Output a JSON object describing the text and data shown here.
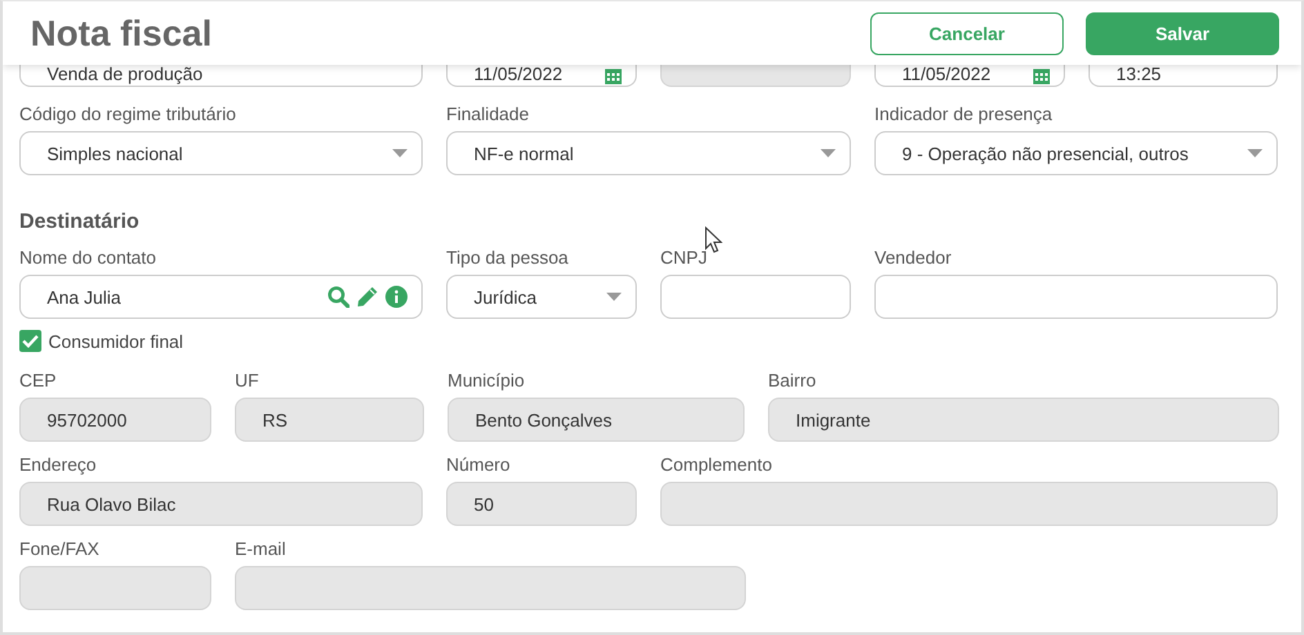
{
  "header": {
    "title": "Nota fiscal",
    "buttons": [
      {
        "label": "Cancelar",
        "kind": "secondary"
      },
      {
        "label": "Salvar",
        "kind": "primary"
      }
    ]
  },
  "top_fields": [
    {
      "kind": "text",
      "value": "Venda de produção",
      "disabled": false
    },
    {
      "kind": "date",
      "value": "11/05/2022",
      "disabled": false
    },
    {
      "kind": "text",
      "disabled": true
    },
    {
      "kind": "date",
      "value": "11/05/2022",
      "disabled": false
    },
    {
      "kind": "text",
      "value": "13:25",
      "disabled": false
    }
  ],
  "fiscal_fields": [
    {
      "label": "Código do regime tributário",
      "kind": "select",
      "value": "Simples nacional",
      "disabled": false
    },
    {
      "label": "Finalidade",
      "kind": "select",
      "value": "NF-e normal",
      "disabled": false
    },
    {
      "label": "Indicador de presença",
      "kind": "select",
      "value": "9 - Operação não presencial, outros",
      "disabled": false
    }
  ],
  "recipient": {
    "heading": "Destinatário",
    "contact_fields": [
      {
        "label": "Nome do contato",
        "kind": "contact",
        "value": "Ana Julia",
        "disabled": false
      },
      {
        "label": "Tipo da pessoa",
        "kind": "select",
        "value": "Jurídica",
        "disabled": false
      },
      {
        "label": "CNPJ",
        "kind": "text",
        "disabled": false
      },
      {
        "label": "Vendedor",
        "kind": "text",
        "disabled": false
      }
    ],
    "final_consumer": {
      "label": "Consumidor final",
      "checked": true
    },
    "address_fields": [
      {
        "label": "CEP",
        "kind": "text",
        "value": "95702000",
        "disabled": true
      },
      {
        "label": "UF",
        "kind": "text",
        "value": "RS",
        "disabled": true
      },
      {
        "label": "Município",
        "kind": "text",
        "value": "Bento Gonçalves",
        "disabled": true
      },
      {
        "label": "Bairro",
        "kind": "text",
        "value": "Imigrante",
        "disabled": true
      }
    ],
    "street_fields": [
      {
        "label": "Endereço",
        "kind": "text",
        "value": "Rua Olavo Bilac",
        "disabled": true
      },
      {
        "label": "Número",
        "kind": "text",
        "value": "50",
        "disabled": true
      },
      {
        "label": "Complemento",
        "kind": "text",
        "disabled": true
      }
    ],
    "contact_info_fields": [
      {
        "label": "Fone/FAX",
        "kind": "text",
        "disabled": true
      },
      {
        "label": "E-mail",
        "kind": "text",
        "disabled": true
      }
    ]
  }
}
